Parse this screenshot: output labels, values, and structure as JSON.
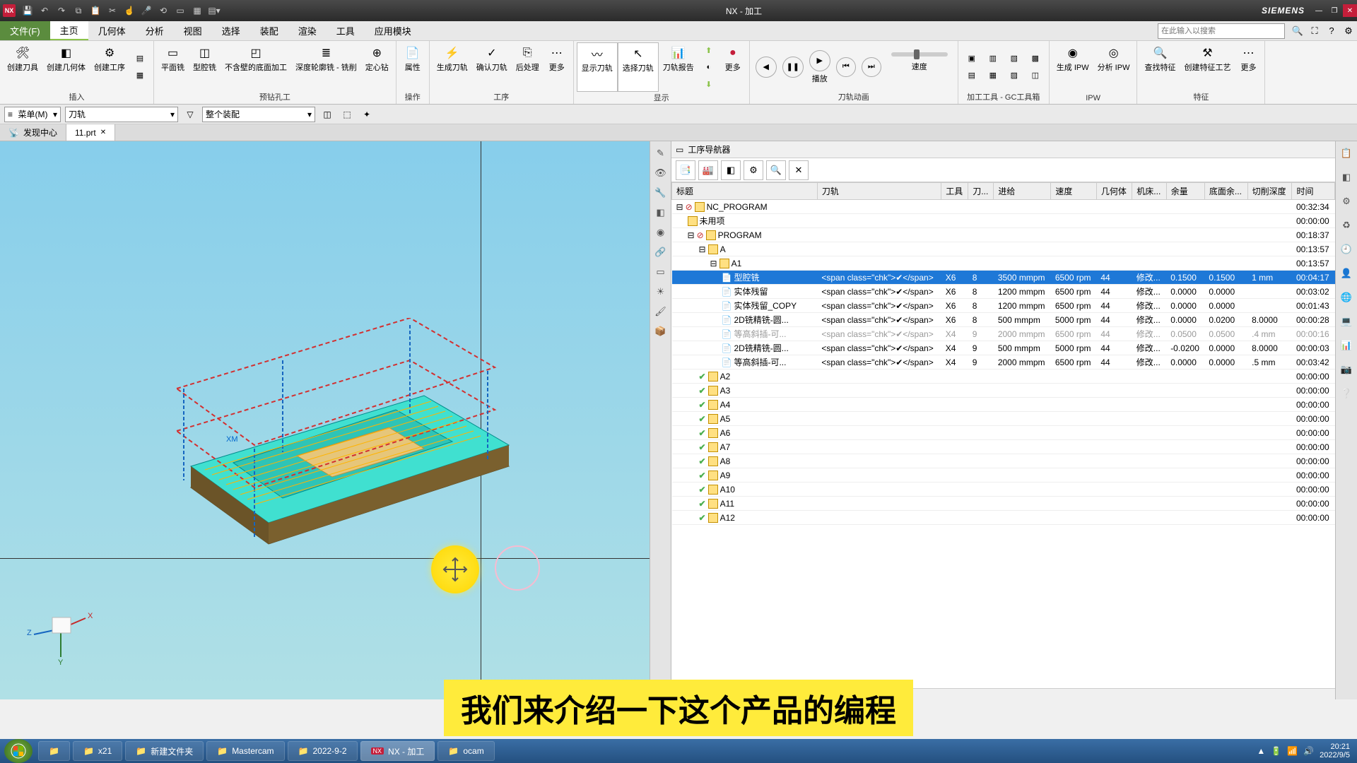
{
  "title": "NX - 加工",
  "brand": "SIEMENS",
  "menu": {
    "file": "文件(F)",
    "tabs": [
      "主页",
      "几何体",
      "分析",
      "视图",
      "选择",
      "装配",
      "渲染",
      "工具",
      "应用模块"
    ],
    "search_placeholder": "在此输入以搜索"
  },
  "ribbon": {
    "insert_group": "插入",
    "create_tool": "创建刀具",
    "create_geom": "创建几何体",
    "create_op": "创建工序",
    "prog_group": "预钻孔工",
    "face_mill": "平面铣",
    "cavity_mill": "型腔铣",
    "floor_wall": "不含壁的底面加工",
    "depth_profile": "深度轮廓铣 - 铣削",
    "drilling": "定心钻",
    "ops_group": "操作",
    "props": "属性",
    "tool_group": "工序",
    "gen_path": "生成刀轨",
    "verify_path": "确认刀轨",
    "post_process": "后处理",
    "op_more": "更多",
    "display_group": "显示",
    "show_path": "显示刀轨",
    "select_path": "选择刀轨",
    "path_report": "刀轨报告",
    "anim_group": "刀轨动画",
    "play": "播放",
    "speed": "速度",
    "gc_group": "加工工具 - GC工具箱",
    "ipw_group": "IPW",
    "gen_ipw": "生成 IPW",
    "analyze_ipw": "分析 IPW",
    "feat_group": "特征",
    "find_feat": "查找特征",
    "create_feat_op": "创建特征工艺",
    "more": "更多"
  },
  "selbar": {
    "menu": "菜单(M)",
    "filter1": "刀轨",
    "filter2": "整个装配"
  },
  "tabs": {
    "discovery": "发现中心",
    "file": "11.prt"
  },
  "navigator": {
    "title": "工序导航器",
    "columns": [
      "标题",
      "刀轨",
      "工具",
      "刀...",
      "进给",
      "速度",
      "几何体",
      "机床...",
      "余量",
      "底面余...",
      "切削深度",
      "时间"
    ],
    "root": {
      "name": "NC_PROGRAM",
      "time": "00:32:34"
    },
    "unused": {
      "name": "未用项",
      "time": "00:00:00"
    },
    "program": {
      "name": "PROGRAM",
      "time": "00:18:37"
    },
    "gA": {
      "name": "A",
      "time": "00:13:57"
    },
    "gA1": {
      "name": "A1",
      "time": "00:13:57"
    },
    "ops": [
      {
        "name": "型腔铣",
        "tool": "X6",
        "dia": "8",
        "feed": "3500 mmpm",
        "speed": "6500 rpm",
        "geom": "44",
        "mc": "修改...",
        "stock": "0.1500",
        "floor": "0.1500",
        "depth": "1 mm",
        "time": "00:04:17",
        "sel": true
      },
      {
        "name": "实体残留",
        "tool": "X6",
        "dia": "8",
        "feed": "1200 mmpm",
        "speed": "6500 rpm",
        "geom": "44",
        "mc": "修改...",
        "stock": "0.0000",
        "floor": "0.0000",
        "depth": "",
        "time": "00:03:02"
      },
      {
        "name": "实体残留_COPY",
        "tool": "X6",
        "dia": "8",
        "feed": "1200 mmpm",
        "speed": "6500 rpm",
        "geom": "44",
        "mc": "修改...",
        "stock": "0.0000",
        "floor": "0.0000",
        "depth": "",
        "time": "00:01:43"
      },
      {
        "name": "2D铣精铣-圆...",
        "tool": "X6",
        "dia": "8",
        "feed": "500 mmpm",
        "speed": "5000 rpm",
        "geom": "44",
        "mc": "修改...",
        "stock": "0.0000",
        "floor": "0.0200",
        "depth": "8.0000",
        "time": "00:00:28"
      },
      {
        "name": "等高斜插-可...",
        "tool": "X4",
        "dia": "9",
        "feed": "2000 mmpm",
        "speed": "6500 rpm",
        "geom": "44",
        "mc": "修改...",
        "stock": "0.0500",
        "floor": "0.0500",
        "depth": ".4 mm",
        "time": "00:00:16",
        "gray": true
      },
      {
        "name": "2D铣精铣-圆...",
        "tool": "X4",
        "dia": "9",
        "feed": "500 mmpm",
        "speed": "5000 rpm",
        "geom": "44",
        "mc": "修改...",
        "stock": "-0.0200",
        "floor": "0.0000",
        "depth": "8.0000",
        "time": "00:00:03"
      },
      {
        "name": "等高斜插-可...",
        "tool": "X4",
        "dia": "9",
        "feed": "2000 mmpm",
        "speed": "6500 rpm",
        "geom": "44",
        "mc": "修改...",
        "stock": "0.0000",
        "floor": "0.0000",
        "depth": ".5 mm",
        "time": "00:03:42"
      }
    ],
    "empty_groups": [
      {
        "name": "A2",
        "time": "00:00:00"
      },
      {
        "name": "A3",
        "time": "00:00:00"
      },
      {
        "name": "A4",
        "time": "00:00:00"
      },
      {
        "name": "A5",
        "time": "00:00:00"
      },
      {
        "name": "A6",
        "time": "00:00:00"
      },
      {
        "name": "A7",
        "time": "00:00:00"
      },
      {
        "name": "A8",
        "time": "00:00:00"
      },
      {
        "name": "A9",
        "time": "00:00:00"
      },
      {
        "name": "A10",
        "time": "00:00:00"
      },
      {
        "name": "A11",
        "time": "00:00:00"
      },
      {
        "name": "A12",
        "time": "00:00:00"
      }
    ]
  },
  "subtitle": "我们来介绍一下这个产品的编程",
  "taskbar": {
    "items": [
      "x21",
      "新建文件夹",
      "Mastercam",
      "2022-9-2",
      "NX - 加工",
      "ocam"
    ],
    "time": "20:21",
    "date": "2022/9/5"
  },
  "triad": {
    "x": "X",
    "y": "Y",
    "z": "Z"
  }
}
